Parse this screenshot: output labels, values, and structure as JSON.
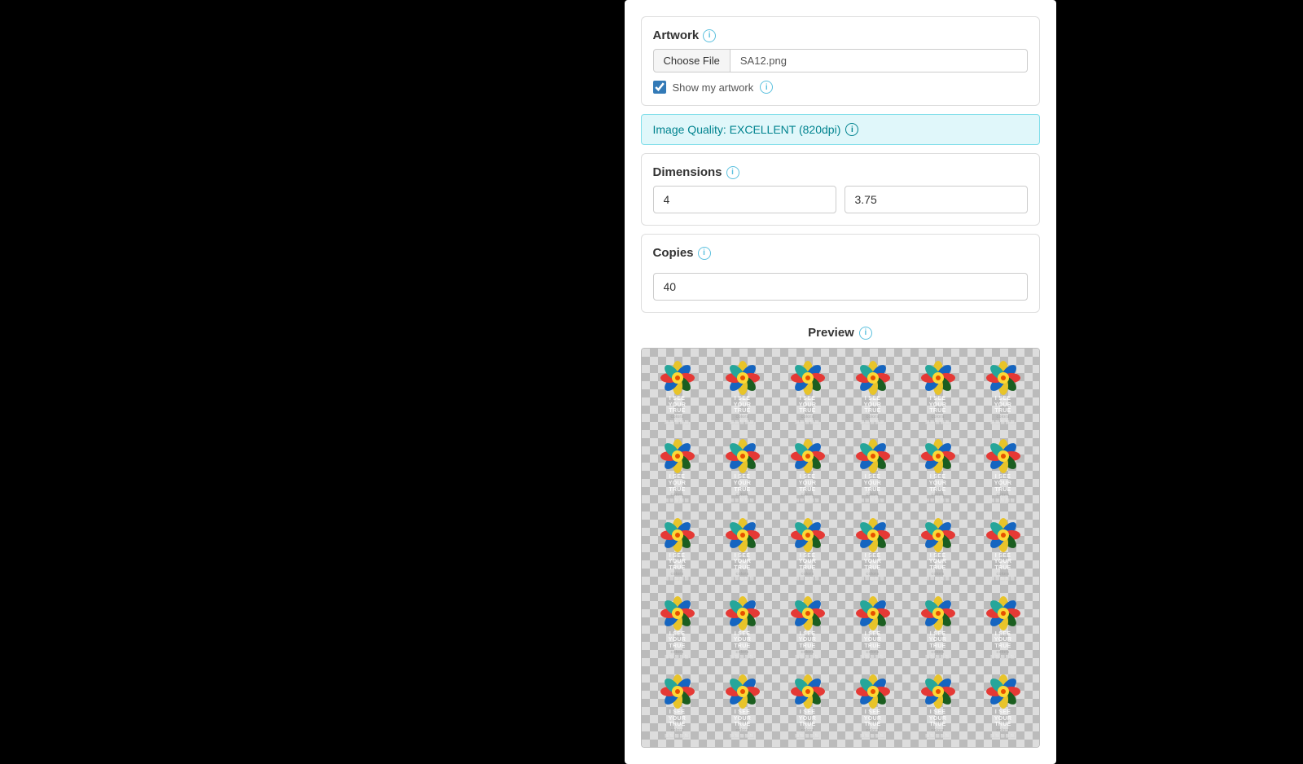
{
  "artwork": {
    "label": "Artwork",
    "choose_file_label": "Choose File",
    "file_name": "SA12.png",
    "show_artwork_label": "Show my artwork"
  },
  "image_quality": {
    "label": "Image Quality: EXCELLENT (820dpi)"
  },
  "dimensions": {
    "label": "Dimensions",
    "width_value": "4",
    "height_value": "3.75"
  },
  "copies": {
    "label": "Copies",
    "value": "40"
  },
  "preview": {
    "label": "Preview"
  },
  "sticker_text": {
    "line1": "I SEE",
    "line2": "YOUR",
    "line3": "TRUE",
    "sub": "colors"
  }
}
